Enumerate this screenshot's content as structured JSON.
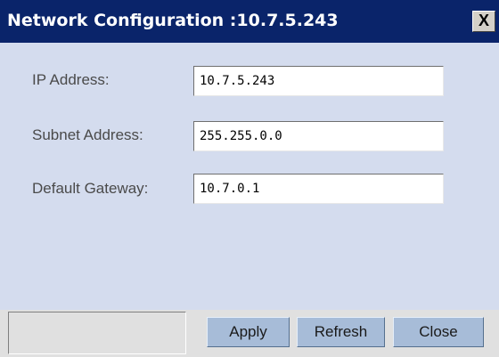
{
  "window": {
    "title": "Network Configuration :10.7.5.243",
    "close_glyph": "X"
  },
  "form": {
    "fields": [
      {
        "label": "IP Address:",
        "value": "10.7.5.243"
      },
      {
        "label": "Subnet Address:",
        "value": "255.255.0.0"
      },
      {
        "label": "Default Gateway:",
        "value": "10.7.0.1"
      }
    ]
  },
  "buttons": {
    "apply": "Apply",
    "refresh": "Refresh",
    "close": "Close"
  },
  "colors": {
    "titlebar": "#0a246a",
    "body": "#d4dcee",
    "button": "#a7bcd8"
  }
}
